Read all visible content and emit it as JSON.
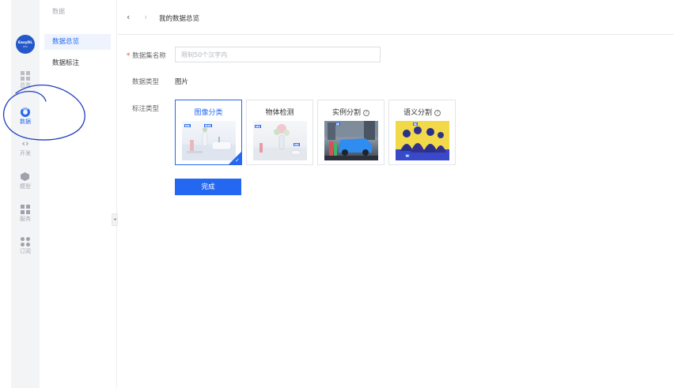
{
  "rail": {
    "logo": {
      "text": "EasyDL",
      "sub": "PRO"
    },
    "items": [
      {
        "label": "总览",
        "icon": "overview-grid-icon"
      },
      {
        "label": "数据",
        "icon": "data-ring-icon",
        "active": true
      },
      {
        "label": "开发",
        "icon": "code-icon"
      },
      {
        "label": "模型",
        "icon": "cube-icon"
      },
      {
        "label": "服务",
        "icon": "service-bars-icon"
      },
      {
        "label": "订阅",
        "icon": "subscription-dots-icon"
      }
    ]
  },
  "subnav": {
    "heading": "数据",
    "items": [
      {
        "label": "数据总览",
        "active": true
      },
      {
        "label": "数据标注"
      }
    ],
    "collapse_glyph": "◂"
  },
  "header": {
    "back_glyph": "‹",
    "forward_glyph": "›",
    "breadcrumb": "我的数据总览"
  },
  "form": {
    "name_label": "数据集名称",
    "required_mark": "*",
    "name_placeholder": "限制50个汉字内",
    "name_value": "",
    "type_label": "数据类型",
    "type_value": "图片",
    "annotation_label": "标注类型",
    "annotation_types": [
      {
        "label": "图像分类",
        "selected": true,
        "help": false
      },
      {
        "label": "物体检测",
        "selected": false,
        "help": false
      },
      {
        "label": "实例分割",
        "selected": false,
        "help": true
      },
      {
        "label": "语义分割",
        "selected": false,
        "help": true
      }
    ],
    "help_glyph": "?",
    "submit_label": "完成"
  },
  "colors": {
    "accent": "#2468f2",
    "required": "#e84a3c",
    "annotation_ink": "#1f3fbf"
  }
}
